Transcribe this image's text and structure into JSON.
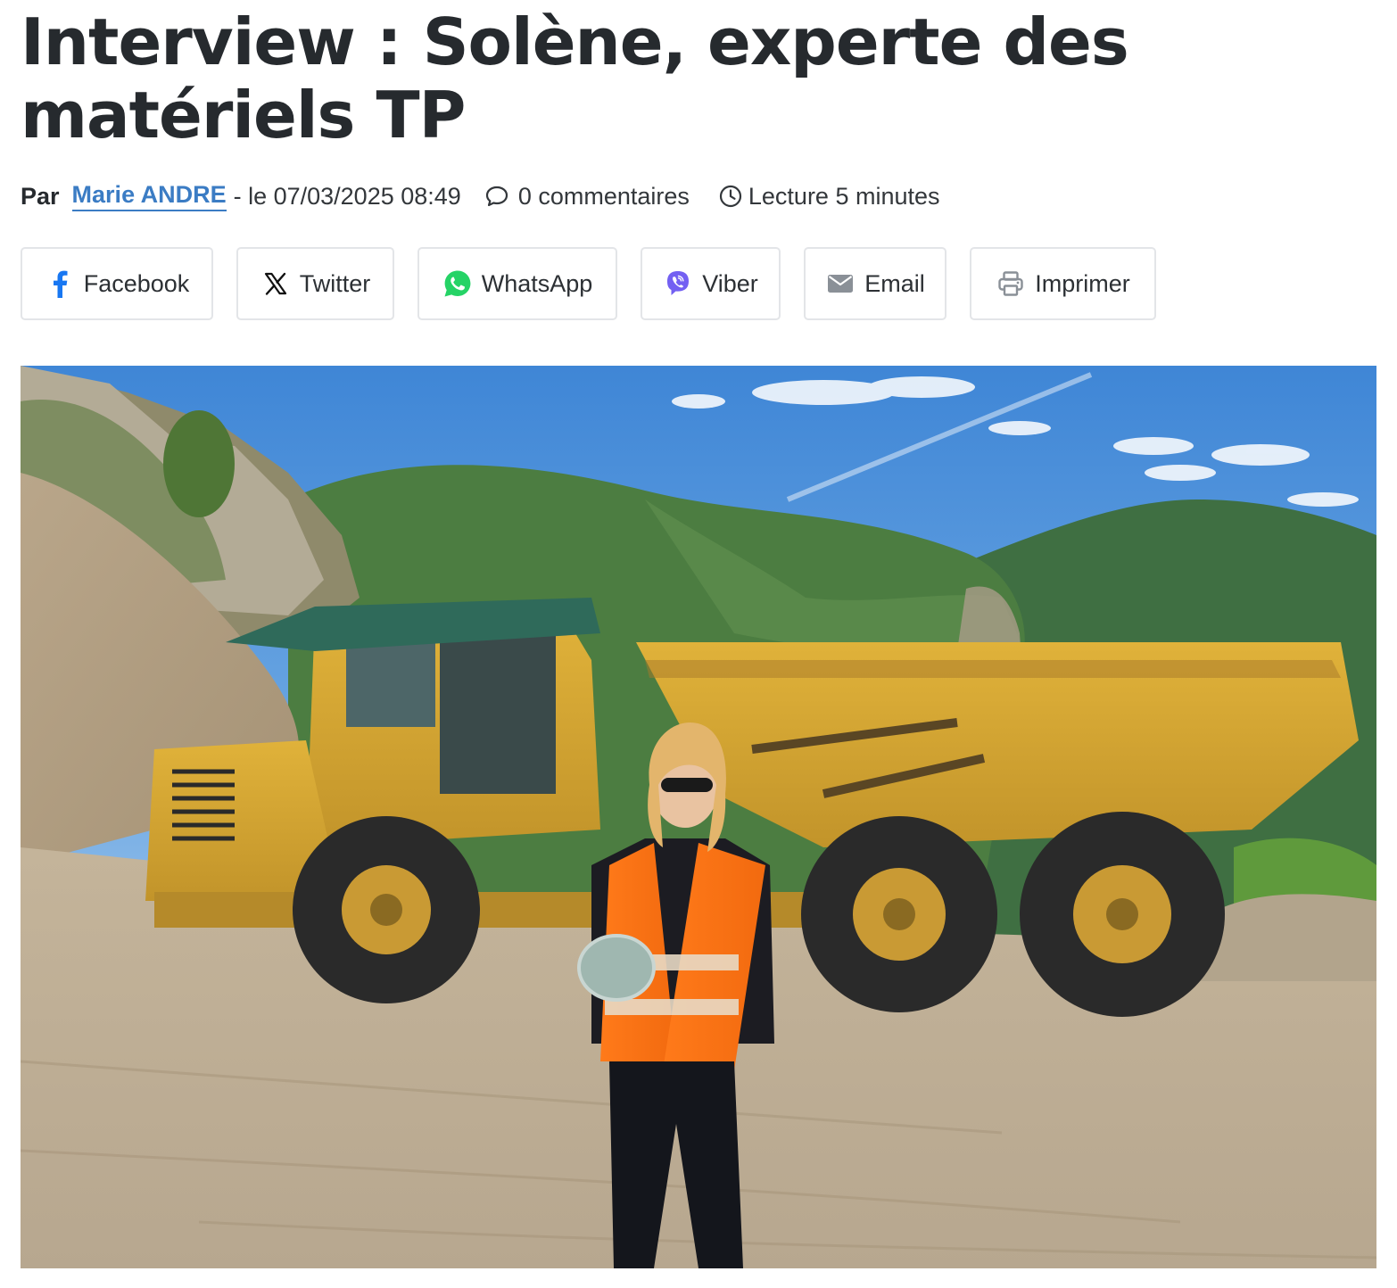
{
  "article": {
    "title": "Interview : Solène, experte des matériels TP",
    "byline": {
      "prefix": "Par",
      "author": "Marie ANDRE",
      "date_text": "- le 07/03/2025 08:49",
      "comments": "0 commentaires",
      "reading_time": "Lecture 5 minutes"
    },
    "share_buttons": [
      {
        "label": "Facebook",
        "icon": "facebook-icon",
        "color": "#1877f2"
      },
      {
        "label": "Twitter",
        "icon": "x-twitter-icon",
        "color": "#111111"
      },
      {
        "label": "WhatsApp",
        "icon": "whatsapp-icon",
        "color": "#25d366"
      },
      {
        "label": "Viber",
        "icon": "viber-icon",
        "color": "#7360f2"
      },
      {
        "label": "Email",
        "icon": "envelope-icon",
        "color": "#8a9097"
      },
      {
        "label": "Imprimer",
        "icon": "printer-icon",
        "color": "#8a9097"
      }
    ],
    "hero_image": {
      "icon": "photo"
    }
  },
  "colors": {
    "text": "#262a2e",
    "link": "#3b7cc4",
    "border": "#e3e5e8"
  }
}
